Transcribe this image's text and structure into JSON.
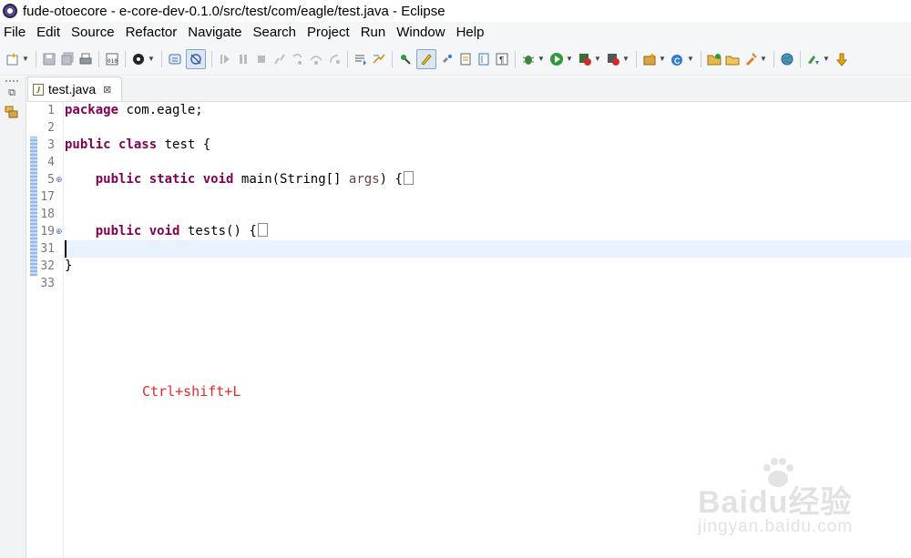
{
  "window": {
    "title": "fude-otoecore - e-core-dev-0.1.0/src/test/com/eagle/test.java - Eclipse"
  },
  "menu": [
    "File",
    "Edit",
    "Source",
    "Refactor",
    "Navigate",
    "Search",
    "Project",
    "Run",
    "Window",
    "Help"
  ],
  "toolbar": {
    "icons": [
      "new-icon",
      "save-icon",
      "save-all-icon",
      "print-icon",
      "binary-icon",
      "profile-icon",
      "task-icon",
      "skip-breakpoints-icon",
      "resume-icon",
      "suspend-icon",
      "terminate-icon",
      "disconnect-icon",
      "step-into-icon",
      "step-over-icon",
      "step-return-icon",
      "drop-to-frame-icon",
      "use-step-filters-icon",
      "open-type-icon",
      "toggle-mark-occurrences-icon",
      "toggle-block-selection-icon",
      "show-whitespace-icon",
      "pilcrow-icon",
      "debug-icon",
      "run-icon",
      "coverage-icon",
      "external-tools-icon",
      "new-java-project-icon",
      "new-class-icon",
      "open-folder-icon",
      "open-file-icon",
      "publish-icon",
      "globe-icon",
      "next-annotation-icon",
      "prev-annotation-icon"
    ]
  },
  "editor": {
    "tab": {
      "label": "test.java",
      "close": "⊠"
    },
    "lines": [
      {
        "n": "1",
        "text": "package com.eagle;"
      },
      {
        "n": "2",
        "text": ""
      },
      {
        "n": "3",
        "text": "public class test {"
      },
      {
        "n": "4",
        "text": ""
      },
      {
        "n": "5",
        "text": "    public static void main(String[] args) {"
      },
      {
        "n": "17",
        "text": ""
      },
      {
        "n": "18",
        "text": ""
      },
      {
        "n": "19",
        "text": "    public void tests() {"
      },
      {
        "n": "31",
        "text": ""
      },
      {
        "n": "32",
        "text": "}"
      },
      {
        "n": "33",
        "text": ""
      }
    ],
    "current_line": "31"
  },
  "annotation": {
    "text": "Ctrl+shift+L",
    "color": "#e4282a"
  },
  "watermark": {
    "main": "Baidu经验",
    "sub": "jingyan.baidu.com"
  }
}
